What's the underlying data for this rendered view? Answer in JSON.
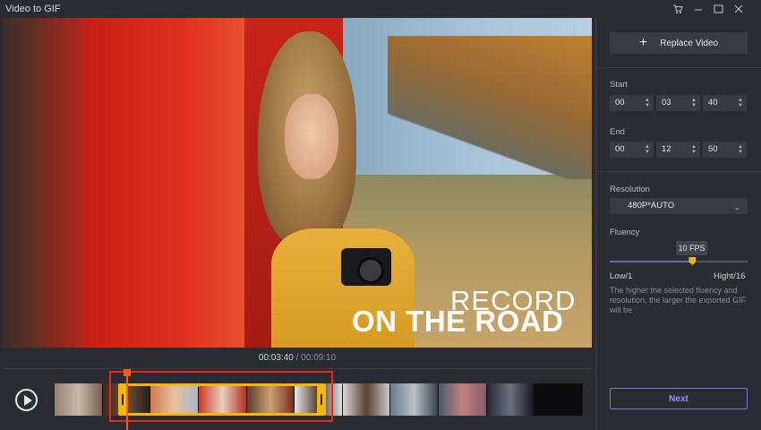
{
  "window": {
    "title": "Video to GIF",
    "controls": [
      "cart-icon",
      "minimize-icon",
      "maximize-icon",
      "close-icon"
    ]
  },
  "video": {
    "overlay_line1": "RECORD",
    "overlay_line2": "ON THE ROAD"
  },
  "timecode": {
    "current": "00:03:40",
    "separator": "/",
    "total": "00:09:10"
  },
  "panel": {
    "replace_label": "Replace Video",
    "start": {
      "label": "Start",
      "h": "00",
      "m": "03",
      "s": "40"
    },
    "end": {
      "label": "End",
      "h": "00",
      "m": "12",
      "s": "50"
    },
    "resolution": {
      "label": "Resolution",
      "value": "480P*AUTO"
    },
    "fluency": {
      "label": "Fluency",
      "value": "10 FPS",
      "level_fraction": 0.6,
      "low": "Low/1",
      "high": "Hight/16",
      "hint": "The higher the selected fluency and resolution, the larger the exported GIF will be"
    },
    "next_label": "Next"
  },
  "colors": {
    "accent": "#7d74d8",
    "selection_border": "#e52a1e",
    "range_handle": "#f5b60d",
    "playhead": "#ff5a1a"
  }
}
